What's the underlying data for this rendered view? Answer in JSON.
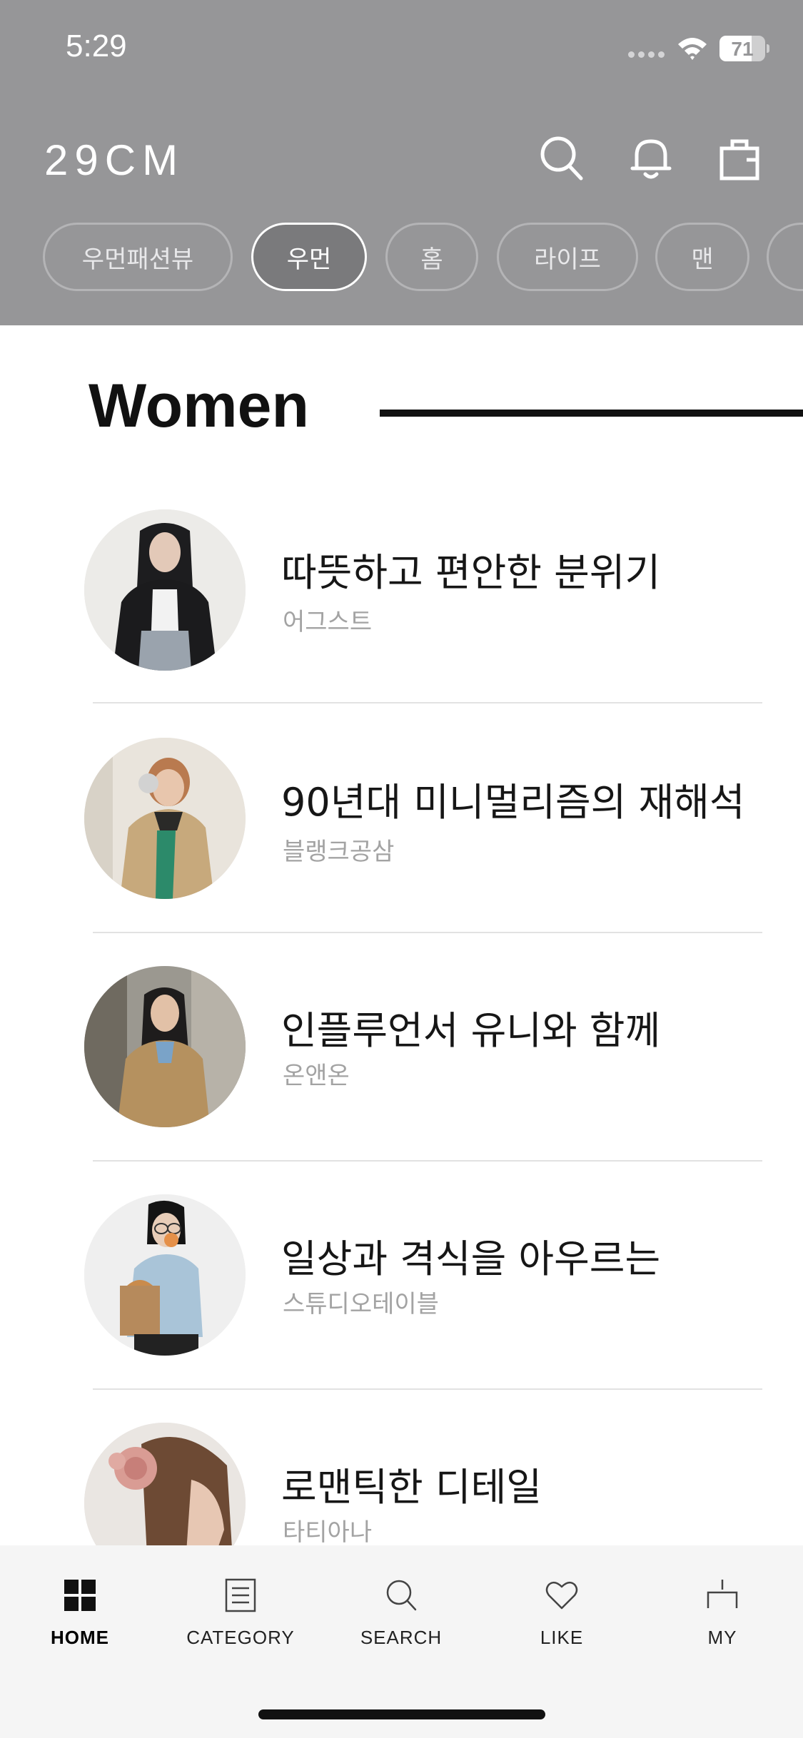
{
  "status_bar": {
    "time": "5:29",
    "battery": "71",
    "battery_level": 0.71
  },
  "header": {
    "logo": "29CM",
    "icons": [
      "search-icon",
      "bell-icon",
      "shopping-bag-icon"
    ]
  },
  "tabs": [
    {
      "label": "우먼패션뷰",
      "active": false
    },
    {
      "label": "우먼",
      "active": true
    },
    {
      "label": "홈",
      "active": false
    },
    {
      "label": "라이프",
      "active": false
    },
    {
      "label": "맨",
      "active": false
    }
  ],
  "section": {
    "title": "Women"
  },
  "items": [
    {
      "title": "따뜻하고 편안한 분위기",
      "brand": "어그스트"
    },
    {
      "title": "90년대 미니멀리즘의 재해석",
      "brand": "블랭크공삼"
    },
    {
      "title": "인플루언서 유니와 함께",
      "brand": "온앤온"
    },
    {
      "title": "일상과 격식을 아우르는",
      "brand": "스튜디오테이블"
    },
    {
      "title": "로맨틱한 디테일",
      "brand": "타티아나"
    }
  ],
  "bottom_nav": [
    {
      "label": "HOME",
      "icon": "home-grid-icon",
      "active": true
    },
    {
      "label": "CATEGORY",
      "icon": "category-list-icon",
      "active": false
    },
    {
      "label": "SEARCH",
      "icon": "search-icon",
      "active": false
    },
    {
      "label": "LIKE",
      "icon": "heart-icon",
      "active": false
    },
    {
      "label": "MY",
      "icon": "my-icon",
      "active": false
    }
  ],
  "colors": {
    "header_bg": "#969698",
    "accent": "#111111",
    "muted_text": "#a3a3a3"
  }
}
